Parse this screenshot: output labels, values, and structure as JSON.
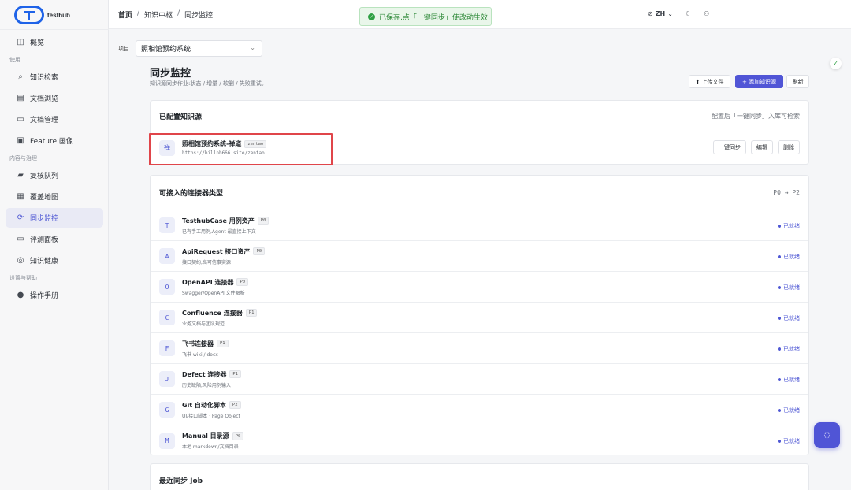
{
  "app": {
    "logo_text": "testhub"
  },
  "breadcrumb": [
    "首页",
    "知识中枢",
    "同步监控"
  ],
  "toast": {
    "text": "已保存,点「一键同步」使改动生效",
    "color": "#2ea043"
  },
  "topbar": {
    "lang": "ZH"
  },
  "sidebar": {
    "overview": "概览",
    "section_use": "使用",
    "use_items": [
      "知识检索",
      "文档浏览",
      "文档管理",
      "Feature 画像"
    ],
    "section_content": "内容与治理",
    "content_items": [
      "复核队列",
      "覆盖地图",
      "同步监控",
      "评测面板",
      "知识健康"
    ],
    "section_help": "设置与帮助",
    "help_items": [
      "操作手册"
    ],
    "active": "同步监控",
    "accent": "#4e57d4"
  },
  "project": {
    "label": "项目",
    "value": "照相馆预约系统"
  },
  "page": {
    "title": "同步监控",
    "subtitle": "知识源同步作业:状态 / 增量 / 软删 / 失败重试。",
    "buttons": {
      "upload": "上传文件",
      "add": "添加知识源",
      "refresh": "刷新"
    }
  },
  "configured": {
    "title": "已配置知识源",
    "hint": "配置后「一键同步」入库可检索",
    "items": [
      {
        "icon": "禅",
        "name": "照相馆预约系统-禅道",
        "tag": "zentao",
        "url": "https://billnb666.site/zentao",
        "actions": [
          "一键同步",
          "编辑",
          "删除"
        ]
      }
    ]
  },
  "connectors": {
    "title": "可接入的连接器类型",
    "hint": "P0 → P2",
    "status_label": "已就绪",
    "items": [
      {
        "icon": "T",
        "name": "TesthubCase 用例资产",
        "tag": "P0",
        "desc": "已有手工用例,Agent 最直接上下文"
      },
      {
        "icon": "A",
        "name": "ApiRequest 接口资产",
        "tag": "P0",
        "desc": "接口契约,高可信事实源"
      },
      {
        "icon": "O",
        "name": "OpenAPI 连接器",
        "tag": "P0",
        "desc": "Swagger/OpenAPI 文件解析"
      },
      {
        "icon": "C",
        "name": "Confluence 连接器",
        "tag": "P1",
        "desc": "业务文档与团队规范"
      },
      {
        "icon": "F",
        "name": "飞书连接器",
        "tag": "P1",
        "desc": "飞书 wiki / docx"
      },
      {
        "icon": "J",
        "name": "Defect 连接器",
        "tag": "P1",
        "desc": "历史缺陷,风险用例输入"
      },
      {
        "icon": "G",
        "name": "Git 自动化脚本",
        "tag": "P2",
        "desc": "UI/接口脚本 · Page Object"
      },
      {
        "icon": "M",
        "name": "Manual 目录源",
        "tag": "P0",
        "desc": "本地 markdown/文档目录"
      }
    ]
  },
  "jobs": {
    "title": "最近同步 Job"
  }
}
